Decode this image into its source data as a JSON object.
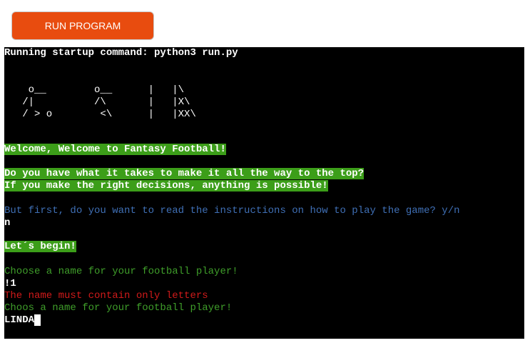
{
  "toolbar": {
    "run_label": "RUN PROGRAM"
  },
  "terminal": {
    "startup": "Running startup command: python3 run.py",
    "art": [
      "    o__        o__      |   |\\",
      "   /|          /\\       |   |X\\",
      "   / > o        <\\      |   |XX\\"
    ],
    "welcome": "Welcome, Welcome to Fantasy Football!",
    "intro_1": "Do you have what it takes to make it all the way to the top?",
    "intro_2": "If you make the right decisions, anything is possible!",
    "instructions_prompt": "But first, do you want to read the instructions on how to play the game? y/n",
    "instructions_answer": "n",
    "begin": "Let´s begin!",
    "name_prompt_1": "Choose a name for your football player!",
    "name_input_1": "!1",
    "name_error": "The name must contain only letters",
    "name_prompt_2": "Choos a name for your football player!",
    "name_input_2": "LINDA"
  },
  "colors": {
    "button": "#e84c0f",
    "highlight": "#3c9e19",
    "prompt_green": "#3f9e2a",
    "prompt_blue": "#3f6fb5",
    "error_red": "#d11a1a"
  }
}
